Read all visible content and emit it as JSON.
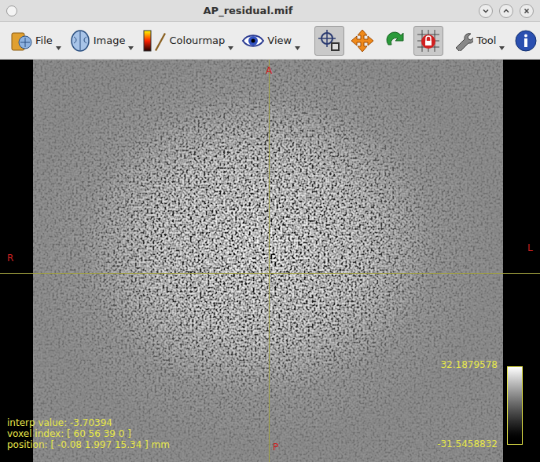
{
  "window": {
    "title": "AP_residual.mif"
  },
  "menus": [
    {
      "label": "File",
      "kind": "file"
    },
    {
      "label": "Image",
      "kind": "image"
    },
    {
      "label": "Colourmap",
      "kind": "colourmap"
    },
    {
      "label": "View",
      "kind": "view"
    }
  ],
  "modes": [
    {
      "kind": "crosshair",
      "selected": true
    },
    {
      "kind": "move",
      "selected": false
    },
    {
      "kind": "rotate",
      "selected": false
    },
    {
      "kind": "lock",
      "selected": true
    }
  ],
  "tool": {
    "label": "Tool"
  },
  "orientation": {
    "top": "A",
    "bottom": "P",
    "left": "R",
    "right": "L"
  },
  "info": [
    "interp value: -3.70394",
    "voxel index: [ 60 56 39 0 ]",
    "position: [ -0.08 1.997 15.34 ] mm"
  ],
  "colorbar": {
    "max": "32.1879578",
    "min": "-31.5458832"
  }
}
